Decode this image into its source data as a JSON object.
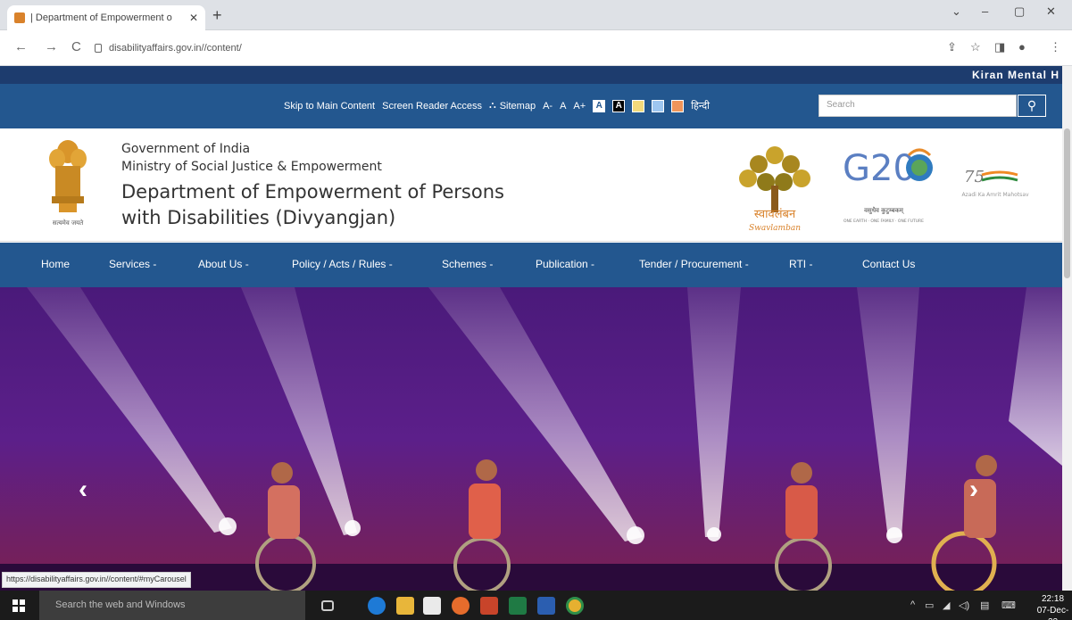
{
  "browser": {
    "tab_title": "| Department of Empowerment o",
    "tab_close": "✕",
    "new_tab": "+",
    "url": "disabilityaffairs.gov.in//content/",
    "back": "←",
    "forward": "→",
    "reload": "C",
    "window_min": "–",
    "window_max": "▢",
    "window_close": "✕",
    "window_down": "⌄",
    "share_icon": "⇪",
    "star_icon": "☆",
    "panel_icon": "◨",
    "profile_icon": "●",
    "menu_icon": "⋮"
  },
  "ticker": {
    "text": "Kiran Mental H"
  },
  "accessibility": {
    "skip": "Skip to Main Content",
    "screen_reader": "Screen Reader Access",
    "sitemap_icon": "⛬",
    "sitemap": "Sitemap",
    "font_minus": "A-",
    "font_normal": "A",
    "font_plus": "A+",
    "contrast_light": "A",
    "contrast_dark": "A",
    "hindi": "हिन्दी",
    "search_placeholder": "Search",
    "search_icon": "⚲",
    "colors": {
      "light": "#ffffff",
      "dark": "#000000",
      "yellow": "#f3d97b",
      "blue": "#9ec6f0",
      "orange": "#f0955a"
    }
  },
  "header": {
    "line1": "Government of India",
    "line2": "Ministry of Social Justice & Empowerment",
    "line3": "Department of Empowerment of Persons",
    "line4": "with Disabilities (Divyangjan)",
    "emblem_caption": "सत्यमेव जयते",
    "swavlamban_text": "स्वावलंबन",
    "swavlamban_en": "Swavlamban",
    "g20_text": "G20",
    "g20_caption": "वसुधैव कुटुम्बकम्",
    "g20_tagline": "ONE EARTH · ONE FAMILY · ONE FUTURE",
    "azadi_text": "Azadi Ka Amrit Mahotsav",
    "azadi_num": "75"
  },
  "nav": {
    "items": [
      {
        "label": "Home"
      },
      {
        "label": "Services -"
      },
      {
        "label": "About Us -"
      },
      {
        "label": "Policy / Acts / Rules -"
      },
      {
        "label": "Schemes -"
      },
      {
        "label": "Publication -"
      },
      {
        "label": "Tender / Procurement -"
      },
      {
        "label": "RTI -"
      },
      {
        "label": "Contact Us"
      }
    ]
  },
  "carousel": {
    "prev": "‹",
    "next": "›"
  },
  "status_url": "https://disabilityaffairs.gov.in//content/#myCarousel",
  "taskbar": {
    "search_text": "Search the web and Windows",
    "time": "22:18",
    "date": "07-Dec-22",
    "tray_chevron": "^",
    "tray_battery": "▭",
    "tray_network": "◢",
    "tray_volume": "◁)",
    "tray_notif": "▤",
    "tray_keyboard": "⌨"
  }
}
